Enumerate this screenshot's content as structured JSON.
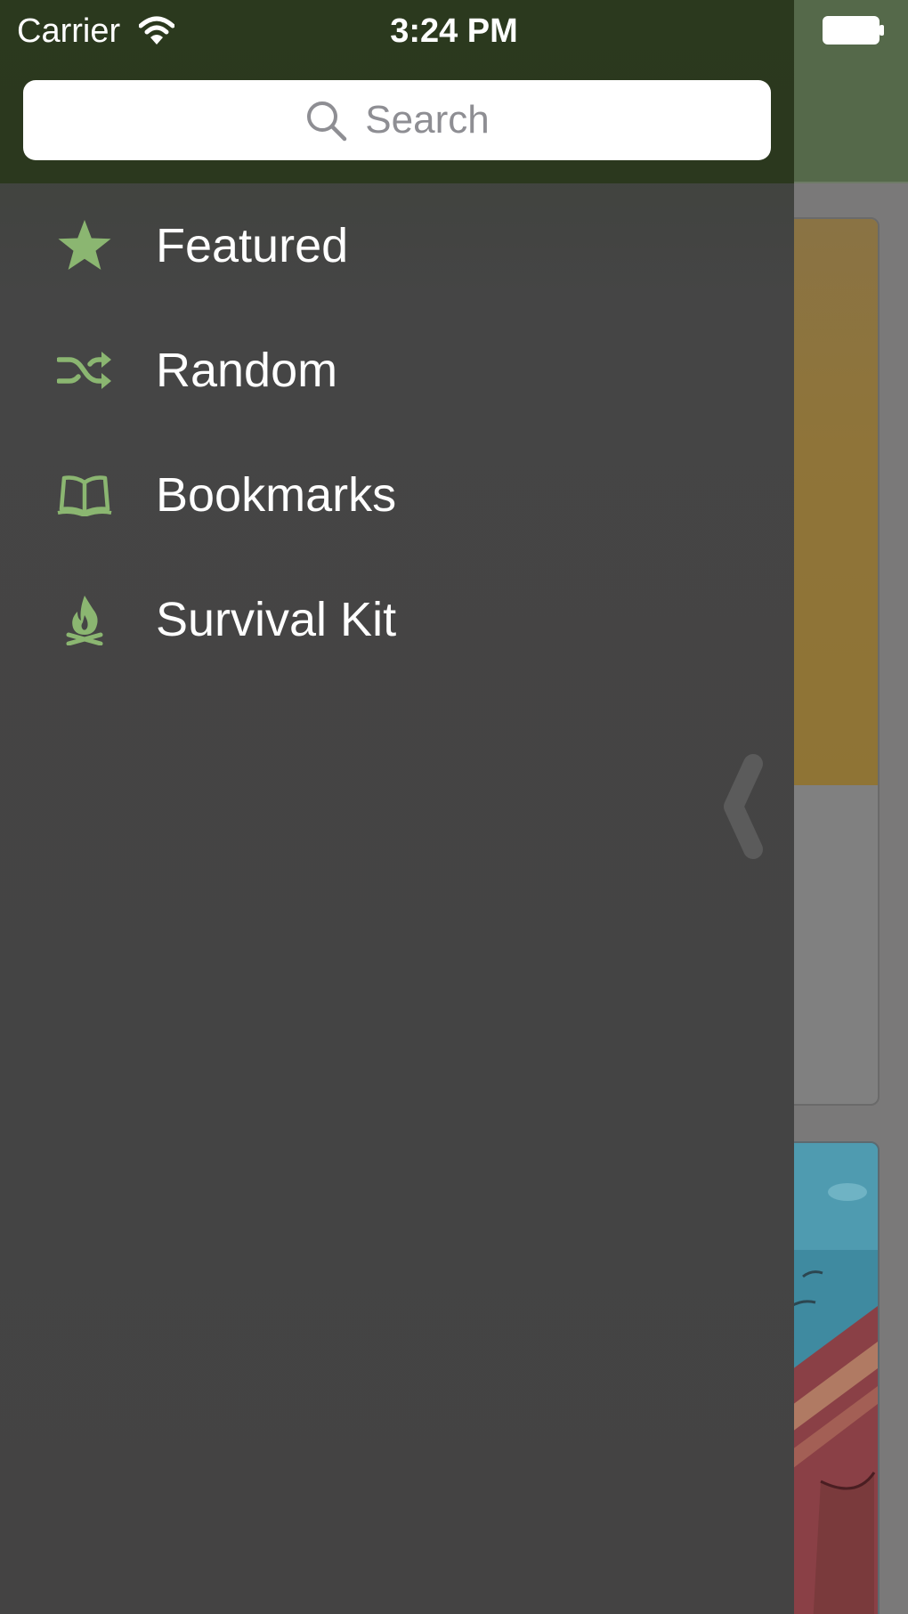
{
  "status_bar": {
    "carrier": "Carrier",
    "time": "3:24 PM"
  },
  "search": {
    "placeholder": "Search"
  },
  "menu": {
    "items": [
      {
        "label": "Featured",
        "icon": "star-icon"
      },
      {
        "label": "Random",
        "icon": "shuffle-icon"
      },
      {
        "label": "Bookmarks",
        "icon": "book-icon"
      },
      {
        "label": "Survival Kit",
        "icon": "campfire-icon"
      }
    ]
  },
  "background": {
    "card_ellipsis": "..."
  },
  "colors": {
    "drawer_header": "#2b391e",
    "drawer_body": "#454545",
    "icon_green": "#8bb671",
    "navbar_green": "#55694a"
  }
}
